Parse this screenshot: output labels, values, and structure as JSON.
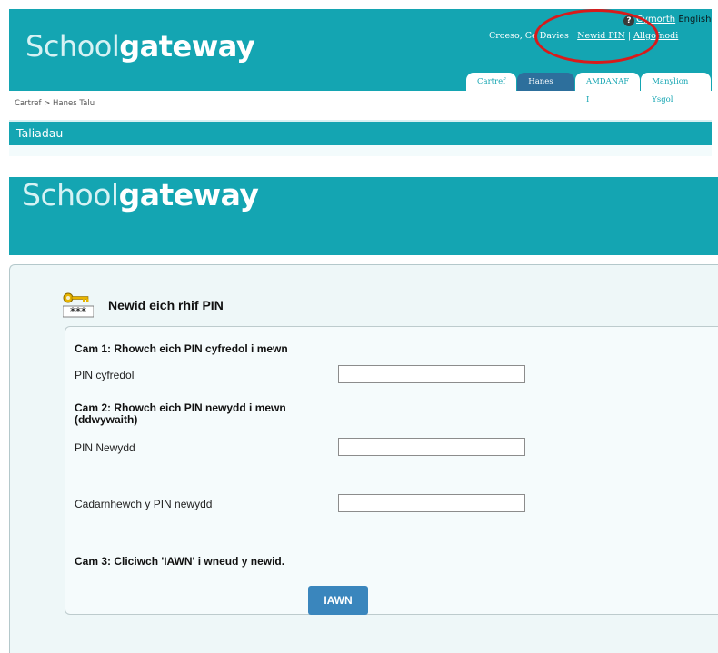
{
  "top": {
    "logo_part1": "Sch",
    "logo_oo": "oo",
    "logo_part2": "l",
    "logo_part3": "gateway",
    "help_icon": "?",
    "lang_link": "Cymorth",
    "lang_english": "English",
    "user_greeting": "Croeso, Ce",
    "user_name": " Davies | ",
    "change_pin_link": "Newid PIN",
    "separator": " | ",
    "logout_link": "Allgofnodi",
    "tabs": [
      {
        "label": "Cartref"
      },
      {
        "label": "Hanes Talu"
      },
      {
        "label": "AMDANAF I"
      },
      {
        "label": "Manylion Ysgol"
      }
    ],
    "breadcrumb": "Cartref  >  Hanes Talu",
    "section_title": "Taliadau"
  },
  "bottom": {
    "logo_part1": "Sch",
    "logo_oo": "oo",
    "logo_part2": "l",
    "logo_part3": "gateway",
    "icon_mask": "***",
    "page_title": "Newid eich rhif PIN",
    "step1": "Cam 1: Rhowch eich PIN cyfredol i mewn",
    "current_pin_label": "PIN cyfredol",
    "step2": "Cam 2: Rhowch eich PIN newydd i mewn (ddwywaith)",
    "new_pin_label": "PIN Newydd",
    "confirm_pin_label": "Cadarnhewch y PIN newydd",
    "step3": "Cam 3: Cliciwch 'IAWN' i wneud y newid.",
    "ok_label": "IAWN"
  },
  "colors": {
    "brand_teal": "#14a5b2",
    "active_tab": "#2d6f9c",
    "annotation_red": "#d81b1b",
    "button_blue": "#3a86bd"
  }
}
